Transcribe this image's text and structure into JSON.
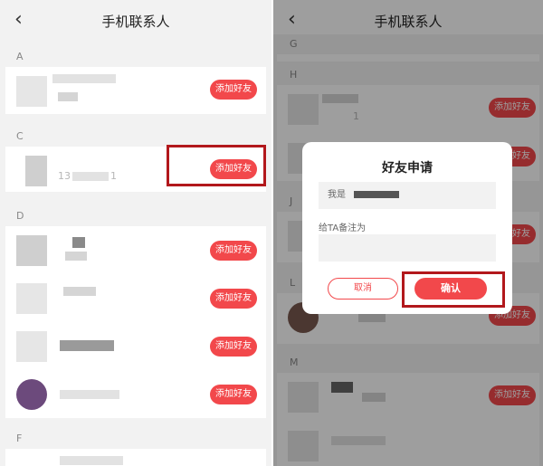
{
  "left": {
    "title": "手机联系人",
    "sections": [
      "A",
      "C",
      "D",
      "F"
    ],
    "add_label": "添加好友",
    "faint_texts": [
      "13",
      "1"
    ]
  },
  "right": {
    "title": "手机联系人",
    "sections": [
      "G",
      "H",
      "J",
      "L",
      "M"
    ],
    "add_label": "添加好友",
    "row_fragment": "1",
    "dialog": {
      "title": "好友申请",
      "i_am": "我是",
      "remark_label": "给TA备注为",
      "cancel": "取消",
      "confirm": "确认"
    }
  },
  "colors": {
    "accent": "#f2484b",
    "highlight": "#b2181c"
  }
}
